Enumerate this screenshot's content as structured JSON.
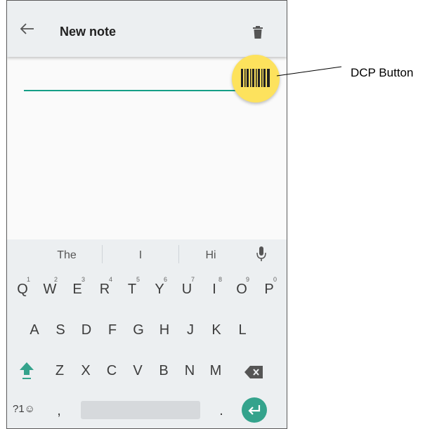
{
  "appbar": {
    "title": "New note"
  },
  "icons": {
    "back": "arrow-back-icon",
    "delete": "trash-icon",
    "dcp": "barcode-icon",
    "mic": "microphone-icon",
    "shift": "shift-icon",
    "backspace": "backspace-icon",
    "enter": "enter-icon"
  },
  "colors": {
    "accent": "#159e86",
    "dcp_button": "#fde25d",
    "appbar": "#eceff1"
  },
  "keyboard": {
    "suggestions": [
      "The",
      "I",
      "Hi"
    ],
    "row1": [
      "Q",
      "W",
      "E",
      "R",
      "T",
      "Y",
      "U",
      "I",
      "O",
      "P"
    ],
    "row1_numbers": [
      "1",
      "2",
      "3",
      "4",
      "5",
      "6",
      "7",
      "8",
      "9",
      "0"
    ],
    "row2": [
      "A",
      "S",
      "D",
      "F",
      "G",
      "H",
      "J",
      "K",
      "L"
    ],
    "row3": [
      "Z",
      "X",
      "C",
      "V",
      "B",
      "N",
      "M"
    ],
    "bottom": {
      "symbols": "?1☺",
      "comma": ",",
      "period": "."
    }
  },
  "callout": {
    "label": "DCP Button"
  }
}
